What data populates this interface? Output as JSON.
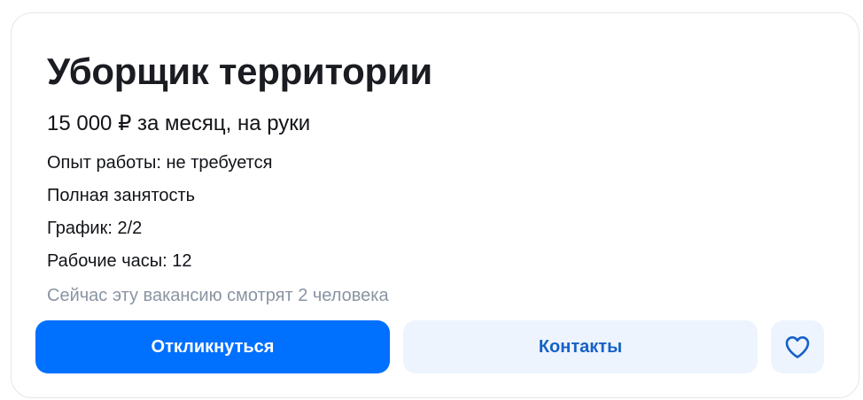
{
  "vacancy": {
    "title": "Уборщик территории",
    "salary": "15 000 ₽ за месяц, на руки",
    "details": [
      "Опыт работы: не требуется",
      "Полная занятость",
      "График: 2/2",
      "Рабочие часы: 12"
    ],
    "viewers": "Сейчас эту вакансию смотрят 2 человека"
  },
  "actions": {
    "respond_label": "Откликнуться",
    "contacts_label": "Контакты",
    "favorite_icon": "heart-icon"
  },
  "colors": {
    "primary": "#0070ff",
    "secondary_bg": "#edf4fd",
    "secondary_text": "#1661c7",
    "muted_text": "#8a94a2"
  }
}
